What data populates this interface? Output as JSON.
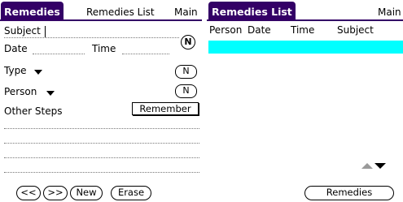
{
  "left": {
    "tab_title": "Remedies",
    "menu": [
      "Remedies List",
      "Main"
    ],
    "subject_label": "Subject",
    "subject_value": "",
    "subject_n": "N",
    "date_label": "Date",
    "time_label": "Time",
    "type_label": "Type",
    "type_n": "N",
    "person_label": "Person",
    "person_n": "N",
    "other_steps_label": "Other Steps",
    "remember_button": "Remember",
    "buttons": {
      "prev": "<<",
      "next": ">>",
      "new": "New",
      "erase": "Erase"
    }
  },
  "right": {
    "tab_title": "Remedies List",
    "menu_main": "Main",
    "columns": [
      "Person",
      "Date",
      "Time",
      "Subject"
    ],
    "rows": [],
    "remedies_button": "Remedies",
    "selected_row_color": "#00ffff"
  },
  "colors": {
    "title_bar": "#330066",
    "title_text": "#ffffff"
  },
  "icons": [
    "scroll-up-icon",
    "scroll-down-icon",
    "dropdown-arrow-icon"
  ]
}
